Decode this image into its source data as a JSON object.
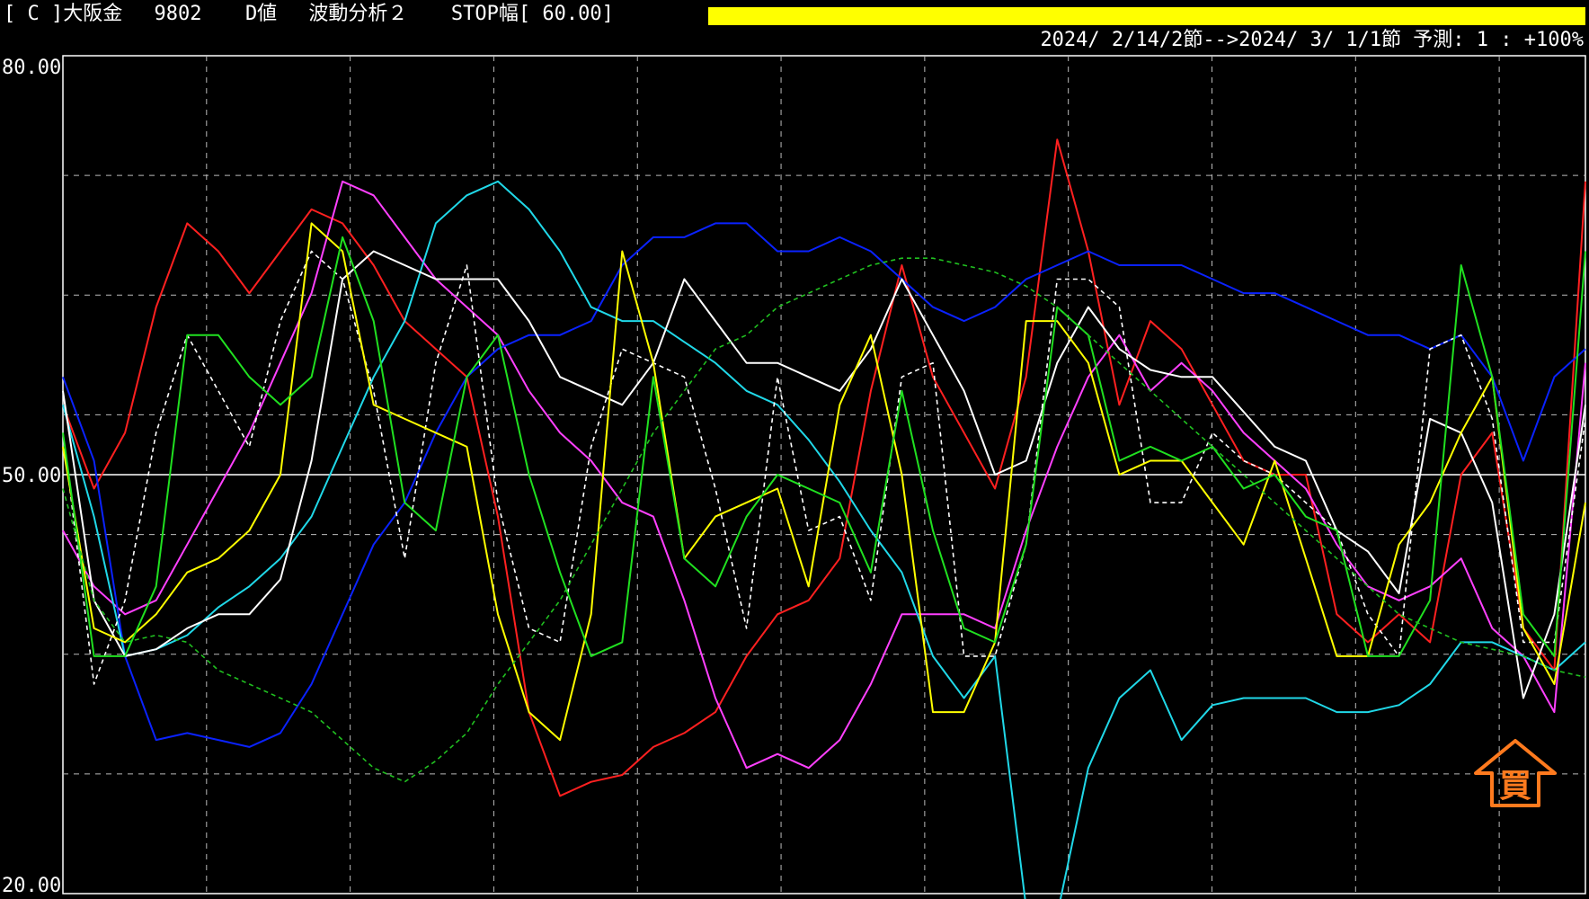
{
  "header": {
    "left_text": "[ C ]大阪金　 9802 　 D値 　波動分析２ 　 STOP幅[ 60.00]",
    "range_text": "2024/ 2/14/2節-->2024/ 3/ 1/1節 予測: 1 : +100%",
    "bar_color": "#ffff00"
  },
  "signal": {
    "label": "買",
    "color": "#ff7a1e"
  },
  "chart_data": {
    "type": "line",
    "ylim": [
      20,
      80
    ],
    "yticks": [
      "80.00",
      "50.00",
      "20.00"
    ],
    "centerline": 50,
    "grid": true,
    "x": [
      0,
      1,
      2,
      3,
      4,
      5,
      6,
      7,
      8,
      9,
      10,
      11,
      12,
      13,
      14,
      15,
      16,
      17,
      18,
      19,
      20,
      21,
      22,
      23,
      24,
      25,
      26,
      27,
      28,
      29,
      30,
      31,
      32,
      33,
      34,
      35,
      36,
      37,
      38,
      39,
      40,
      41,
      42,
      43,
      44,
      45,
      46,
      47,
      48,
      49
    ],
    "series": [
      {
        "color": "#ff2020",
        "dashed": false,
        "values": [
          55,
          49,
          53,
          62,
          68,
          66,
          63,
          66,
          69,
          68,
          65,
          61,
          59,
          57,
          47,
          33,
          27,
          28,
          28.5,
          30.5,
          31.5,
          33,
          37,
          40,
          41,
          44,
          56,
          65,
          57,
          53,
          49,
          57,
          74,
          66,
          55,
          61,
          59,
          55,
          51,
          50,
          50,
          40,
          38,
          40,
          38,
          50,
          53,
          39,
          36,
          71
        ]
      },
      {
        "color": "#ff40ff",
        "dashed": false,
        "values": [
          46,
          42,
          40,
          41,
          45,
          49,
          53,
          58,
          63,
          71,
          70,
          67,
          64,
          62,
          60,
          56,
          53,
          51,
          48,
          47,
          41,
          34,
          29,
          30,
          29,
          31,
          35,
          40,
          40,
          40,
          39,
          46,
          52,
          57,
          60,
          56,
          58,
          56,
          53,
          51,
          49,
          45,
          42,
          41,
          42,
          44,
          39,
          37,
          33,
          58
        ]
      },
      {
        "color": "#0a22ff",
        "dashed": false,
        "values": [
          57,
          51,
          37,
          31,
          31.5,
          31,
          30.5,
          31.5,
          35,
          40,
          45,
          48,
          53,
          57,
          59,
          60,
          60,
          61,
          65,
          67,
          67,
          68,
          68,
          66,
          66,
          67,
          66,
          64,
          62,
          61,
          62,
          64,
          65,
          66,
          65,
          65,
          65,
          64,
          63,
          63,
          62,
          61,
          60,
          60,
          59,
          60,
          57,
          51,
          57,
          59
        ]
      },
      {
        "color": "#20d8e8",
        "dashed": false,
        "values": [
          55,
          47,
          37,
          37.5,
          38.5,
          40.5,
          42,
          44,
          47,
          52,
          57,
          61,
          68,
          70,
          71,
          69,
          66,
          62,
          61,
          61,
          59.5,
          58,
          56,
          55,
          52.5,
          49.5,
          46,
          43,
          37,
          34,
          37,
          19,
          18.5,
          29,
          34,
          36,
          31,
          33.5,
          34,
          34,
          34,
          33,
          33,
          33.5,
          35,
          38,
          38,
          37,
          36,
          38
        ]
      },
      {
        "color": "#ffffff",
        "dashed": false,
        "values": [
          56,
          41,
          37,
          37.5,
          39,
          40,
          40,
          42.5,
          51,
          64,
          66,
          65,
          64,
          64,
          64,
          61,
          57,
          56,
          55,
          58,
          64,
          61,
          58,
          58,
          57,
          56,
          59,
          64,
          60,
          56,
          50,
          51,
          58,
          62,
          59,
          57.5,
          57,
          57,
          54.5,
          52,
          51,
          46,
          44.5,
          41.5,
          54,
          53,
          48,
          34,
          40,
          55
        ]
      },
      {
        "color": "#ffffff",
        "dashed": true,
        "values": [
          53,
          35,
          41,
          53,
          60,
          56,
          52,
          61,
          66,
          64,
          56,
          44,
          58,
          65,
          48,
          39,
          38,
          52,
          59,
          58,
          57,
          49,
          39,
          57,
          46,
          47,
          41,
          57,
          58,
          37,
          37,
          45,
          64,
          64,
          62,
          48,
          48,
          53,
          51,
          50,
          48,
          46,
          40,
          37,
          59,
          60,
          54,
          38,
          38,
          54
        ]
      },
      {
        "color": "#ffff00",
        "dashed": false,
        "values": [
          52,
          39,
          38,
          40,
          43,
          44,
          46,
          50,
          68,
          66,
          55,
          54,
          53,
          52,
          40,
          33,
          31,
          40,
          66,
          58,
          44,
          47,
          48,
          49,
          42,
          55,
          60,
          50,
          33,
          33,
          38,
          61,
          61,
          58,
          50,
          51,
          51,
          48,
          45,
          51,
          44,
          37,
          37,
          45,
          48,
          53,
          57,
          39,
          35,
          48
        ]
      },
      {
        "color": "#20e020",
        "dashed": false,
        "values": [
          53,
          37,
          37,
          42,
          60,
          60,
          57,
          55,
          57,
          67,
          61,
          48,
          46,
          57,
          60,
          50,
          43,
          37,
          38,
          57,
          44,
          42,
          47,
          50,
          49,
          48,
          43,
          56,
          46,
          39,
          38,
          45,
          62,
          60,
          51,
          52,
          51,
          52,
          49,
          50,
          47,
          46,
          37,
          37,
          41,
          65,
          57,
          40,
          37,
          66
        ]
      },
      {
        "color": "#20c020",
        "dashed": true,
        "values": [
          49,
          41,
          38,
          38.5,
          38,
          36,
          35,
          34,
          33,
          31,
          29,
          28,
          29.5,
          31.5,
          35,
          38,
          41,
          45,
          49,
          53,
          56,
          59,
          60,
          62,
          63,
          64,
          65,
          65.5,
          65.5,
          65,
          64.5,
          63.5,
          62,
          60,
          58,
          56,
          54,
          52,
          50,
          48,
          46,
          44,
          42,
          40,
          39,
          38,
          37.5,
          37,
          36,
          35.5
        ]
      }
    ]
  }
}
